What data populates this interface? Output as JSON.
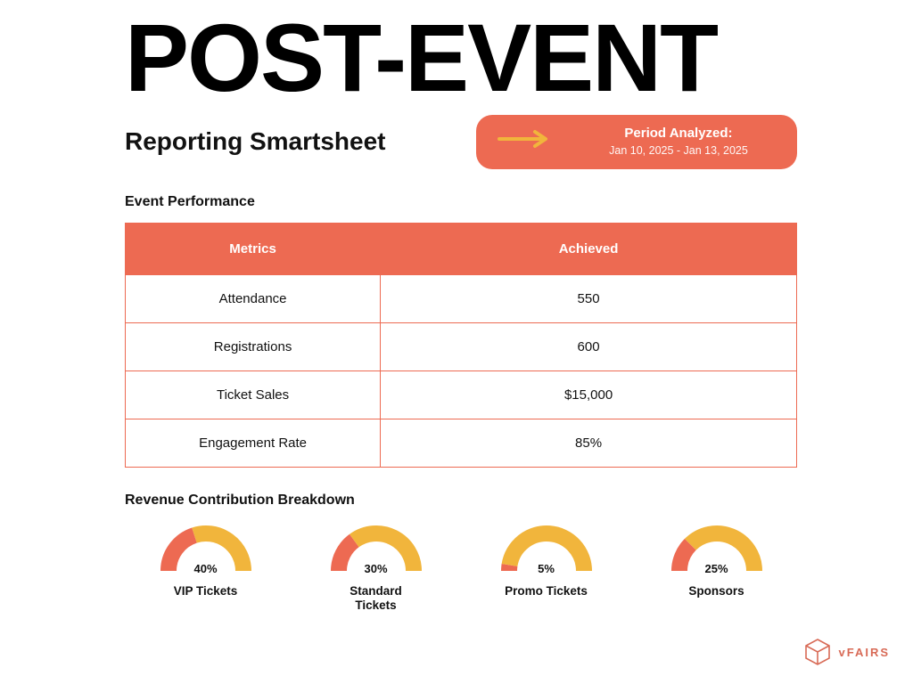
{
  "colors": {
    "accent": "#ed6a52",
    "gauge_fill": "#f1b53c"
  },
  "header": {
    "title": "POST-EVENT",
    "subtitle": "Reporting Smartsheet",
    "period_label": "Period Analyzed:",
    "period_range": "Jan 10, 2025 - Jan 13, 2025"
  },
  "sections": {
    "performance_title": "Event Performance",
    "breakdown_title": "Revenue Contribution Breakdown"
  },
  "performance_table": {
    "headers": {
      "metric": "Metrics",
      "achieved": "Achieved"
    },
    "rows": [
      {
        "metric": "Attendance",
        "achieved": "550"
      },
      {
        "metric": "Registrations",
        "achieved": "600"
      },
      {
        "metric": "Ticket Sales",
        "achieved": "$15,000"
      },
      {
        "metric": "Engagement Rate",
        "achieved": "85%"
      }
    ]
  },
  "chart_data": {
    "type": "gauge",
    "title": "Revenue Contribution Breakdown",
    "unit": "%",
    "series": [
      {
        "name": "VIP Tickets",
        "value": 40
      },
      {
        "name": "Standard Tickets",
        "value": 30
      },
      {
        "name": "Promo Tickets",
        "value": 5
      },
      {
        "name": "Sponsors",
        "value": 25
      }
    ]
  },
  "brand": {
    "name": "vFAIRS"
  }
}
